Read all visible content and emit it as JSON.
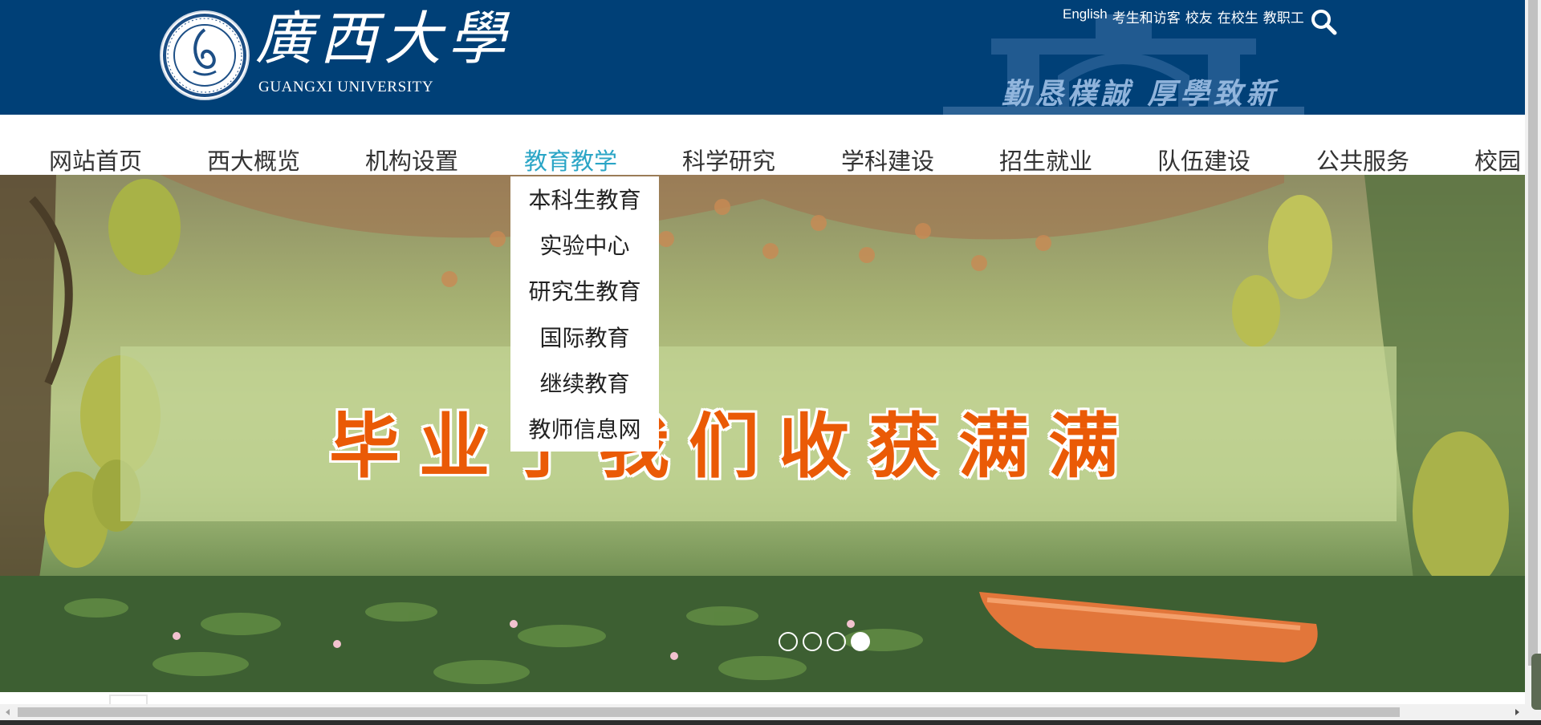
{
  "header": {
    "logo_cn": "廣西大學",
    "logo_en": "GUANGXI UNIVERSITY",
    "motto": "勤恳樸誠 厚學致新",
    "top_links": [
      "English",
      "考生和访客",
      "校友",
      "在校生",
      "教职工"
    ],
    "search_icon": "search-icon",
    "background_color": "#004077"
  },
  "nav": {
    "items": [
      "网站首页",
      "西大概览",
      "机构设置",
      "教育教学",
      "科学研究",
      "学科建设",
      "招生就业",
      "队伍建设",
      "公共服务",
      "校园"
    ],
    "active": "教育教学",
    "active_color": "#2aa5c6"
  },
  "dropdown": {
    "items": [
      "本科生教育",
      "实验中心",
      "研究生教育",
      "国际教育",
      "继续教育",
      "教师信息网"
    ]
  },
  "banner": {
    "slogan": "毕业了我们收获满满",
    "slogan_color": "#ea5a06",
    "slide_count": 4,
    "active_slide": 4
  }
}
